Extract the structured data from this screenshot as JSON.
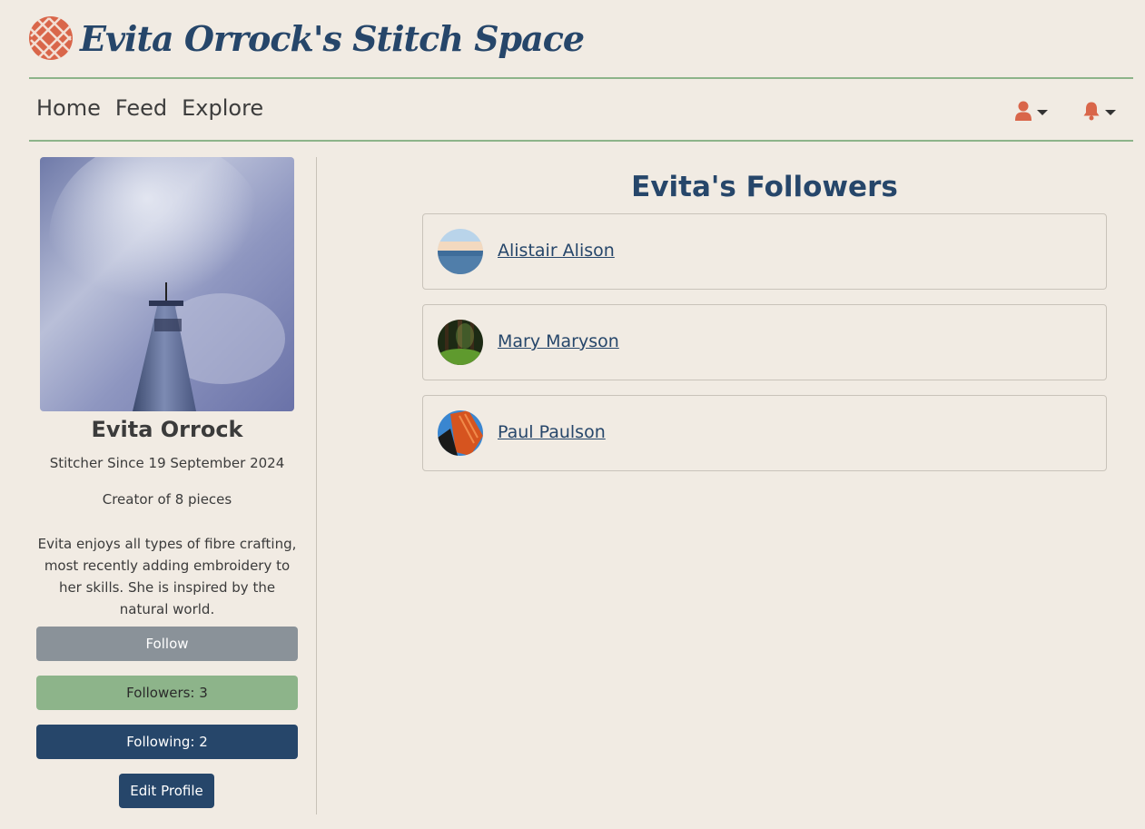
{
  "site": {
    "title": "Evita Orrock's Stitch Space",
    "logo_icon": "cross-stitch-logo",
    "brand_color": "#d9664a",
    "accent_color": "#26466a",
    "rule_color": "#8db48a"
  },
  "nav": {
    "links": [
      {
        "label": "Home"
      },
      {
        "label": "Feed"
      },
      {
        "label": "Explore"
      }
    ],
    "user_menu_icon": "user-icon",
    "notifications_icon": "bell-icon"
  },
  "profile": {
    "photo_icon": "skyscraper-photo",
    "name": "Evita Orrock",
    "since": "Stitcher Since 19 September 2024",
    "pieces": "Creator of 8 pieces",
    "bio": "Evita enjoys all types of fibre crafting, most recently adding embroidery to her skills. She is inspired by the natural world.",
    "follow_label": "Follow",
    "followers_label": "Followers: 3",
    "following_label": "Following: 2",
    "edit_label": "Edit Profile"
  },
  "main": {
    "title": "Evita's Followers",
    "followers": [
      {
        "name": "Alistair Alison",
        "avatar": "ocean-horizon-avatar"
      },
      {
        "name": "Mary Maryson",
        "avatar": "forest-avatar"
      },
      {
        "name": "Paul Paulson",
        "avatar": "bridge-avatar"
      }
    ]
  }
}
